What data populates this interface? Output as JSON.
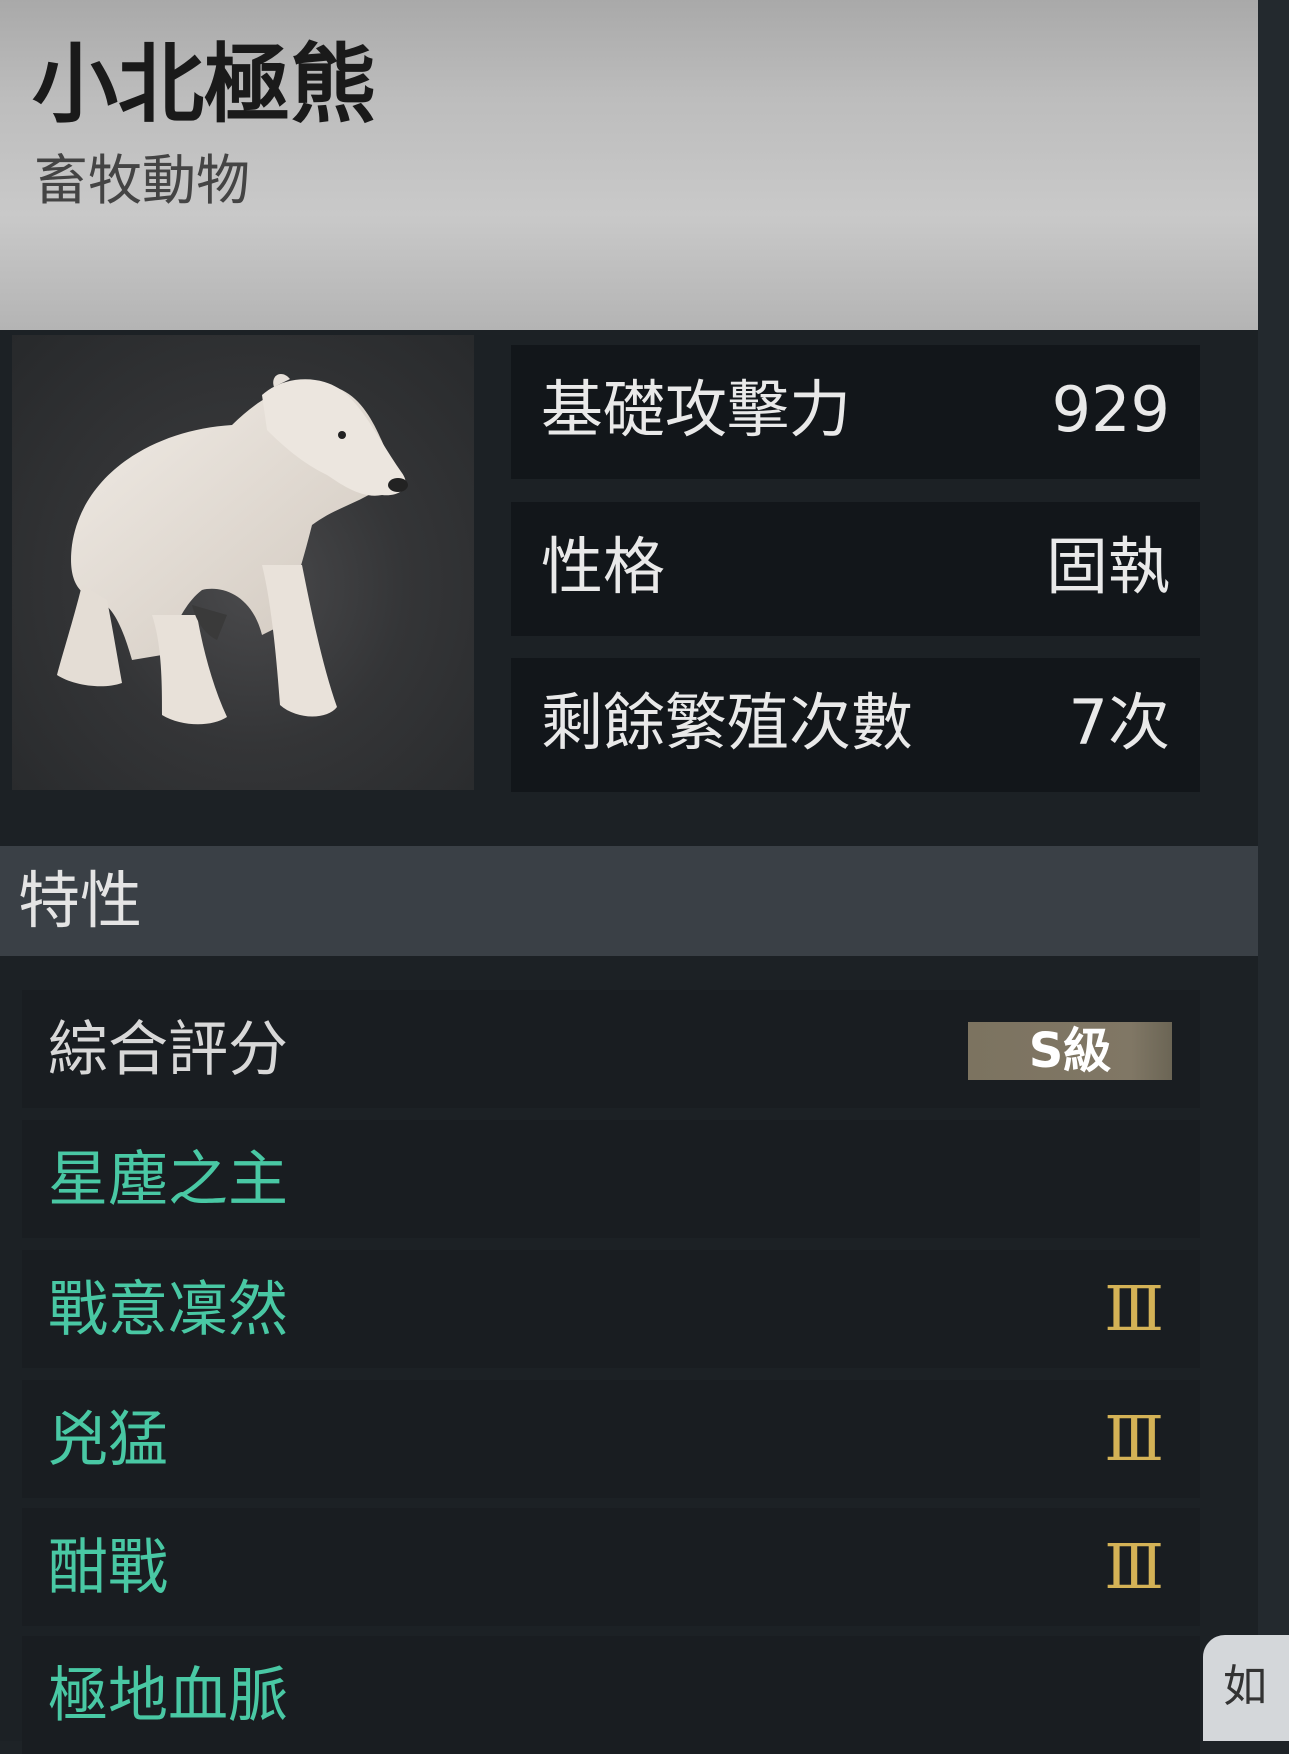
{
  "header": {
    "title": "小北極熊",
    "subtitle": "畜牧動物"
  },
  "stats": [
    {
      "label": "基礎攻擊力",
      "value": "929"
    },
    {
      "label": "性格",
      "value": "固執"
    },
    {
      "label": "剩餘繁殖次數",
      "value": "7次"
    }
  ],
  "traits_section": {
    "title": "特性"
  },
  "overall": {
    "label": "綜合評分",
    "grade": "S級"
  },
  "traits": [
    {
      "name": "星塵之主",
      "level": ""
    },
    {
      "name": "戰意凜然",
      "level": "Ⅲ"
    },
    {
      "name": "兇猛",
      "level": "Ⅲ"
    },
    {
      "name": "酣戰",
      "level": "Ⅲ"
    },
    {
      "name": "極地血脈",
      "level": ""
    }
  ],
  "floating_button": {
    "label": "如"
  },
  "colors": {
    "trait_text": "#49c8a4",
    "level_gold": "#d4b256",
    "grade_badge": "#7c7360"
  }
}
